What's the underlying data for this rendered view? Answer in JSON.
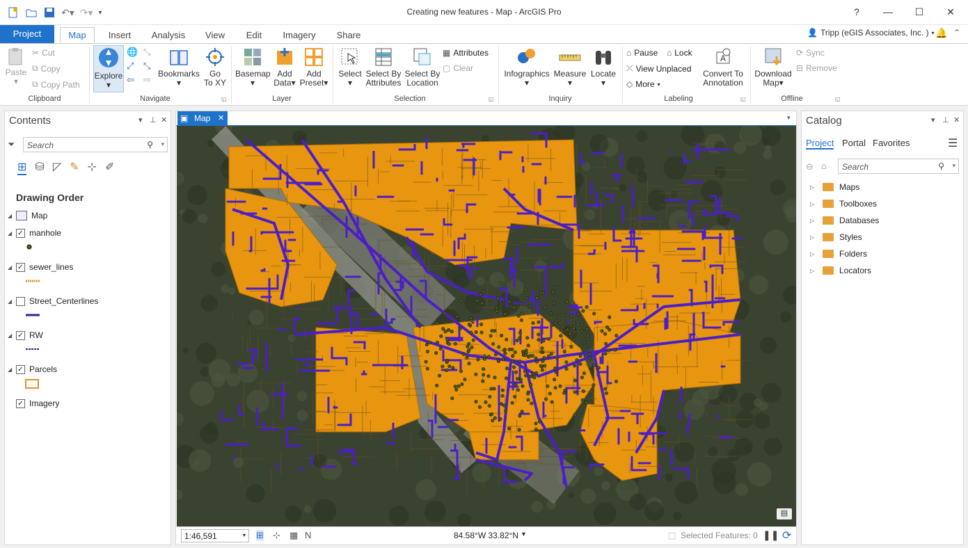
{
  "window": {
    "title": "Creating new features - Map - ArcGIS Pro",
    "help": "?"
  },
  "tabs": [
    "Project",
    "Map",
    "Insert",
    "Analysis",
    "View",
    "Edit",
    "Imagery",
    "Share"
  ],
  "user": {
    "name": "Tripp (eGIS Associates, Inc. )"
  },
  "ribbon": {
    "clipboard": {
      "paste": "Paste",
      "cut": "Cut",
      "copy": "Copy",
      "copy_path": "Copy Path",
      "group": "Clipboard"
    },
    "navigate": {
      "explore": "Explore",
      "bookmarks": "Bookmarks",
      "goto_1": "Go",
      "goto_2": "To XY",
      "group": "Navigate"
    },
    "layer": {
      "basemap": "Basemap",
      "add_data_1": "Add",
      "add_data_2": "Data",
      "add_preset_1": "Add",
      "add_preset_2": "Preset",
      "group": "Layer"
    },
    "selection": {
      "select": "Select",
      "by_attr_1": "Select By",
      "by_attr_2": "Attributes",
      "by_loc_1": "Select By",
      "by_loc_2": "Location",
      "attributes": "Attributes",
      "clear": "Clear",
      "group": "Selection"
    },
    "inquiry": {
      "infographics": "Infographics",
      "measure": "Measure",
      "locate": "Locate",
      "group": "Inquiry"
    },
    "labeling": {
      "pause": "Pause",
      "lock": "Lock",
      "view_unplaced": "View Unplaced",
      "more": "More",
      "convert_1": "Convert To",
      "convert_2": "Annotation",
      "group": "Labeling"
    },
    "offline": {
      "download_1": "Download",
      "download_2": "Map",
      "sync": "Sync",
      "remove": "Remove",
      "group": "Offline"
    }
  },
  "contents": {
    "title": "Contents",
    "search_placeholder": "Search",
    "drawing_order": "Drawing Order",
    "map_name": "Map",
    "layers": [
      {
        "name": "manhole",
        "checked": true
      },
      {
        "name": "sewer_lines",
        "checked": true
      },
      {
        "name": "Street_Centerlines",
        "checked": false
      },
      {
        "name": "RW",
        "checked": true
      },
      {
        "name": "Parcels",
        "checked": true
      },
      {
        "name": "Imagery",
        "checked": true
      }
    ]
  },
  "map_tab": {
    "label": "Map"
  },
  "status": {
    "scale": "1:46,591",
    "coords": "84.58°W 33.82°N",
    "selected": "Selected Features: 0"
  },
  "catalog": {
    "title": "Catalog",
    "tabs": [
      "Project",
      "Portal",
      "Favorites"
    ],
    "search_placeholder": "Search",
    "items": [
      "Maps",
      "Toolboxes",
      "Databases",
      "Styles",
      "Folders",
      "Locators"
    ]
  },
  "colors": {
    "accent": "#1f72c9",
    "parcels": "#e8960f",
    "lines": "#4b1fc8",
    "imagery": "#3a4330"
  }
}
